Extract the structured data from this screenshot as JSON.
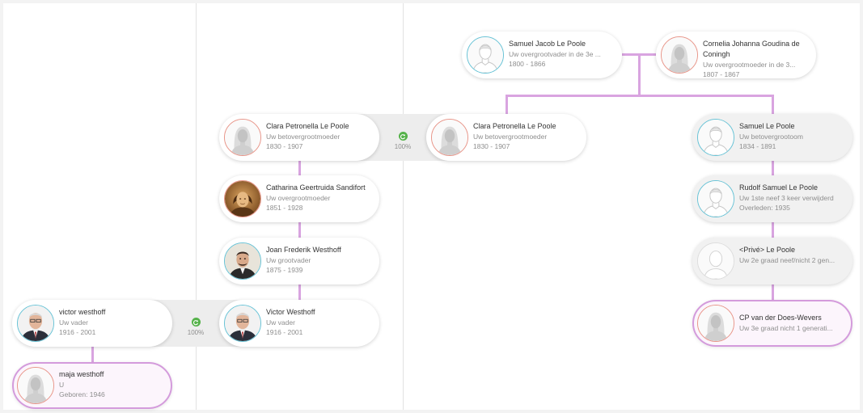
{
  "people": {
    "samuel_jacob": {
      "name": "Samuel Jacob Le Poole",
      "relation": "Uw overgrootvader in de 3e ...",
      "dates": "1800 - 1866",
      "gender": "male",
      "photo": "silhouette"
    },
    "cornelia": {
      "name": "Cornelia Johanna Goudina de Coningh",
      "relation": "Uw overgrootmoeder in de 3...",
      "dates": "1807 - 1867",
      "gender": "female",
      "photo": "silhouette"
    },
    "clara_left": {
      "name": "Clara Petronella Le Poole",
      "relation": "Uw betovergrootmoeder",
      "dates": "1830 - 1907",
      "gender": "female",
      "photo": "silhouette"
    },
    "clara_right": {
      "name": "Clara Petronella Le Poole",
      "relation": "Uw betovergrootmoeder",
      "dates": "1830 - 1907",
      "gender": "female",
      "photo": "silhouette"
    },
    "samuel": {
      "name": "Samuel Le Poole",
      "relation": "Uw betovergrootoom",
      "dates": "1834 - 1891",
      "gender": "male",
      "photo": "silhouette"
    },
    "catharina": {
      "name": "Catharina Geertruida Sandifort",
      "relation": "Uw overgrootmoeder",
      "dates": "1851 - 1928",
      "gender": "female",
      "photo": "sepia-portrait"
    },
    "rudolf": {
      "name": "Rudolf Samuel Le Poole",
      "relation": "Uw 1ste neef 3 keer verwijderd",
      "dates": "Overleden: 1935",
      "gender": "male",
      "photo": "silhouette"
    },
    "joan": {
      "name": "Joan Frederik Westhoff",
      "relation": "Uw grootvader",
      "dates": "1875 - 1939",
      "gender": "male",
      "photo": "portrait"
    },
    "prive": {
      "name": "<Privé> Le Poole",
      "relation": "Uw 2e graad neef/nicht 2 gen...",
      "dates": "",
      "gender": "unknown",
      "photo": "silhouette"
    },
    "victor_left": {
      "name": "victor westhoff",
      "relation": "Uw vader",
      "dates": "1916 - 2001",
      "gender": "male",
      "photo": "portrait"
    },
    "victor_right": {
      "name": "Victor Westhoff",
      "relation": "Uw vader",
      "dates": "1916 - 2001",
      "gender": "male",
      "photo": "portrait"
    },
    "cp": {
      "name": "CP van der Does-Wevers",
      "relation": "Uw 3e graad nicht 1 generati...",
      "dates": "",
      "gender": "female",
      "photo": "silhouette"
    },
    "maja": {
      "name": "maja westhoff",
      "relation": "U",
      "dates": "Geboren: 1946",
      "gender": "female",
      "photo": "silhouette"
    }
  },
  "matches": {
    "clara": {
      "percent": "100%",
      "icon": "refresh-icon"
    },
    "victor": {
      "percent": "100%",
      "icon": "refresh-icon"
    }
  },
  "colors": {
    "connector": "#d9a4e0",
    "female_ring": "#e8968a",
    "male_ring": "#69c3d6",
    "match_green": "#55b24a",
    "highlight_border": "#d49bdc"
  }
}
